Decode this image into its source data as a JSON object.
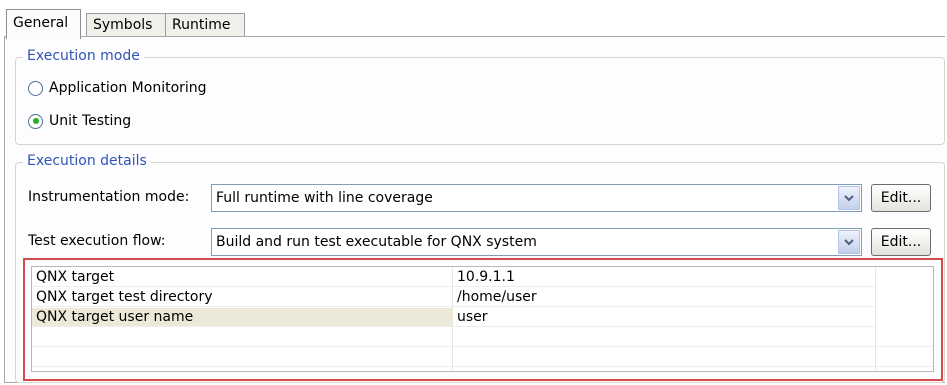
{
  "tabs": [
    {
      "label": "General",
      "active": true
    },
    {
      "label": "Symbols",
      "active": false
    },
    {
      "label": "Runtime",
      "active": false
    }
  ],
  "execution_mode": {
    "title": "Execution mode",
    "options": [
      {
        "label": "Application Monitoring",
        "selected": false
      },
      {
        "label": "Unit Testing",
        "selected": true
      }
    ]
  },
  "execution_details": {
    "title": "Execution details",
    "instrumentation": {
      "label": "Instrumentation mode:",
      "value": "Full runtime with line coverage",
      "edit_label": "Edit..."
    },
    "flow": {
      "label": "Test execution flow:",
      "value": "Build and run test executable for QNX system",
      "edit_label": "Edit..."
    }
  },
  "properties": {
    "rows": [
      {
        "name": "QNX target",
        "value": "10.9.1.1",
        "selected": false
      },
      {
        "name": "QNX target test directory",
        "value": "/home/user",
        "selected": false
      },
      {
        "name": "QNX target user name",
        "value": "user",
        "selected": true
      }
    ]
  },
  "colors": {
    "group_title": "#2f55b5",
    "highlight_border": "#d84a4a",
    "radio_check": "#23b02a",
    "selected_row": "#ece9d8"
  }
}
